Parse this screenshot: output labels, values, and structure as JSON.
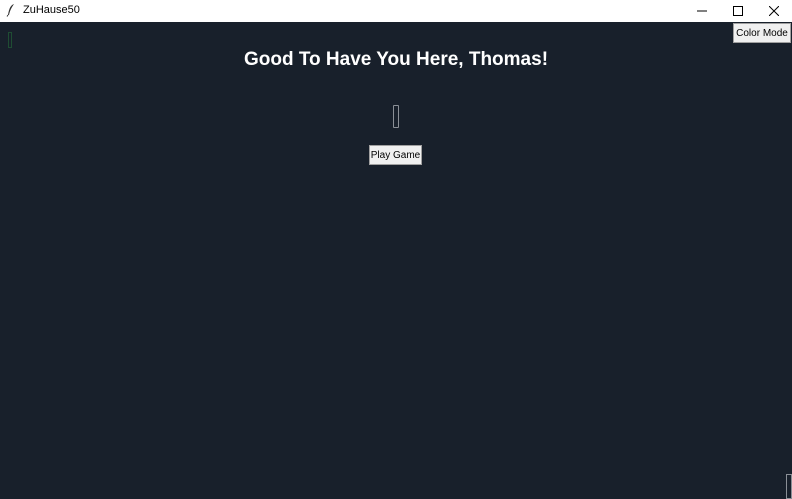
{
  "window": {
    "title": "ZuHause50"
  },
  "controls": {
    "color_mode_label": "Color Mode",
    "play_game_label": "Play Game"
  },
  "main": {
    "greeting": "Good To Have You Here, Thomas!",
    "input_value": ""
  },
  "colors": {
    "background": "#18202b",
    "greeting_text": "#ffffff",
    "button_bg": "#f0f0f0"
  }
}
